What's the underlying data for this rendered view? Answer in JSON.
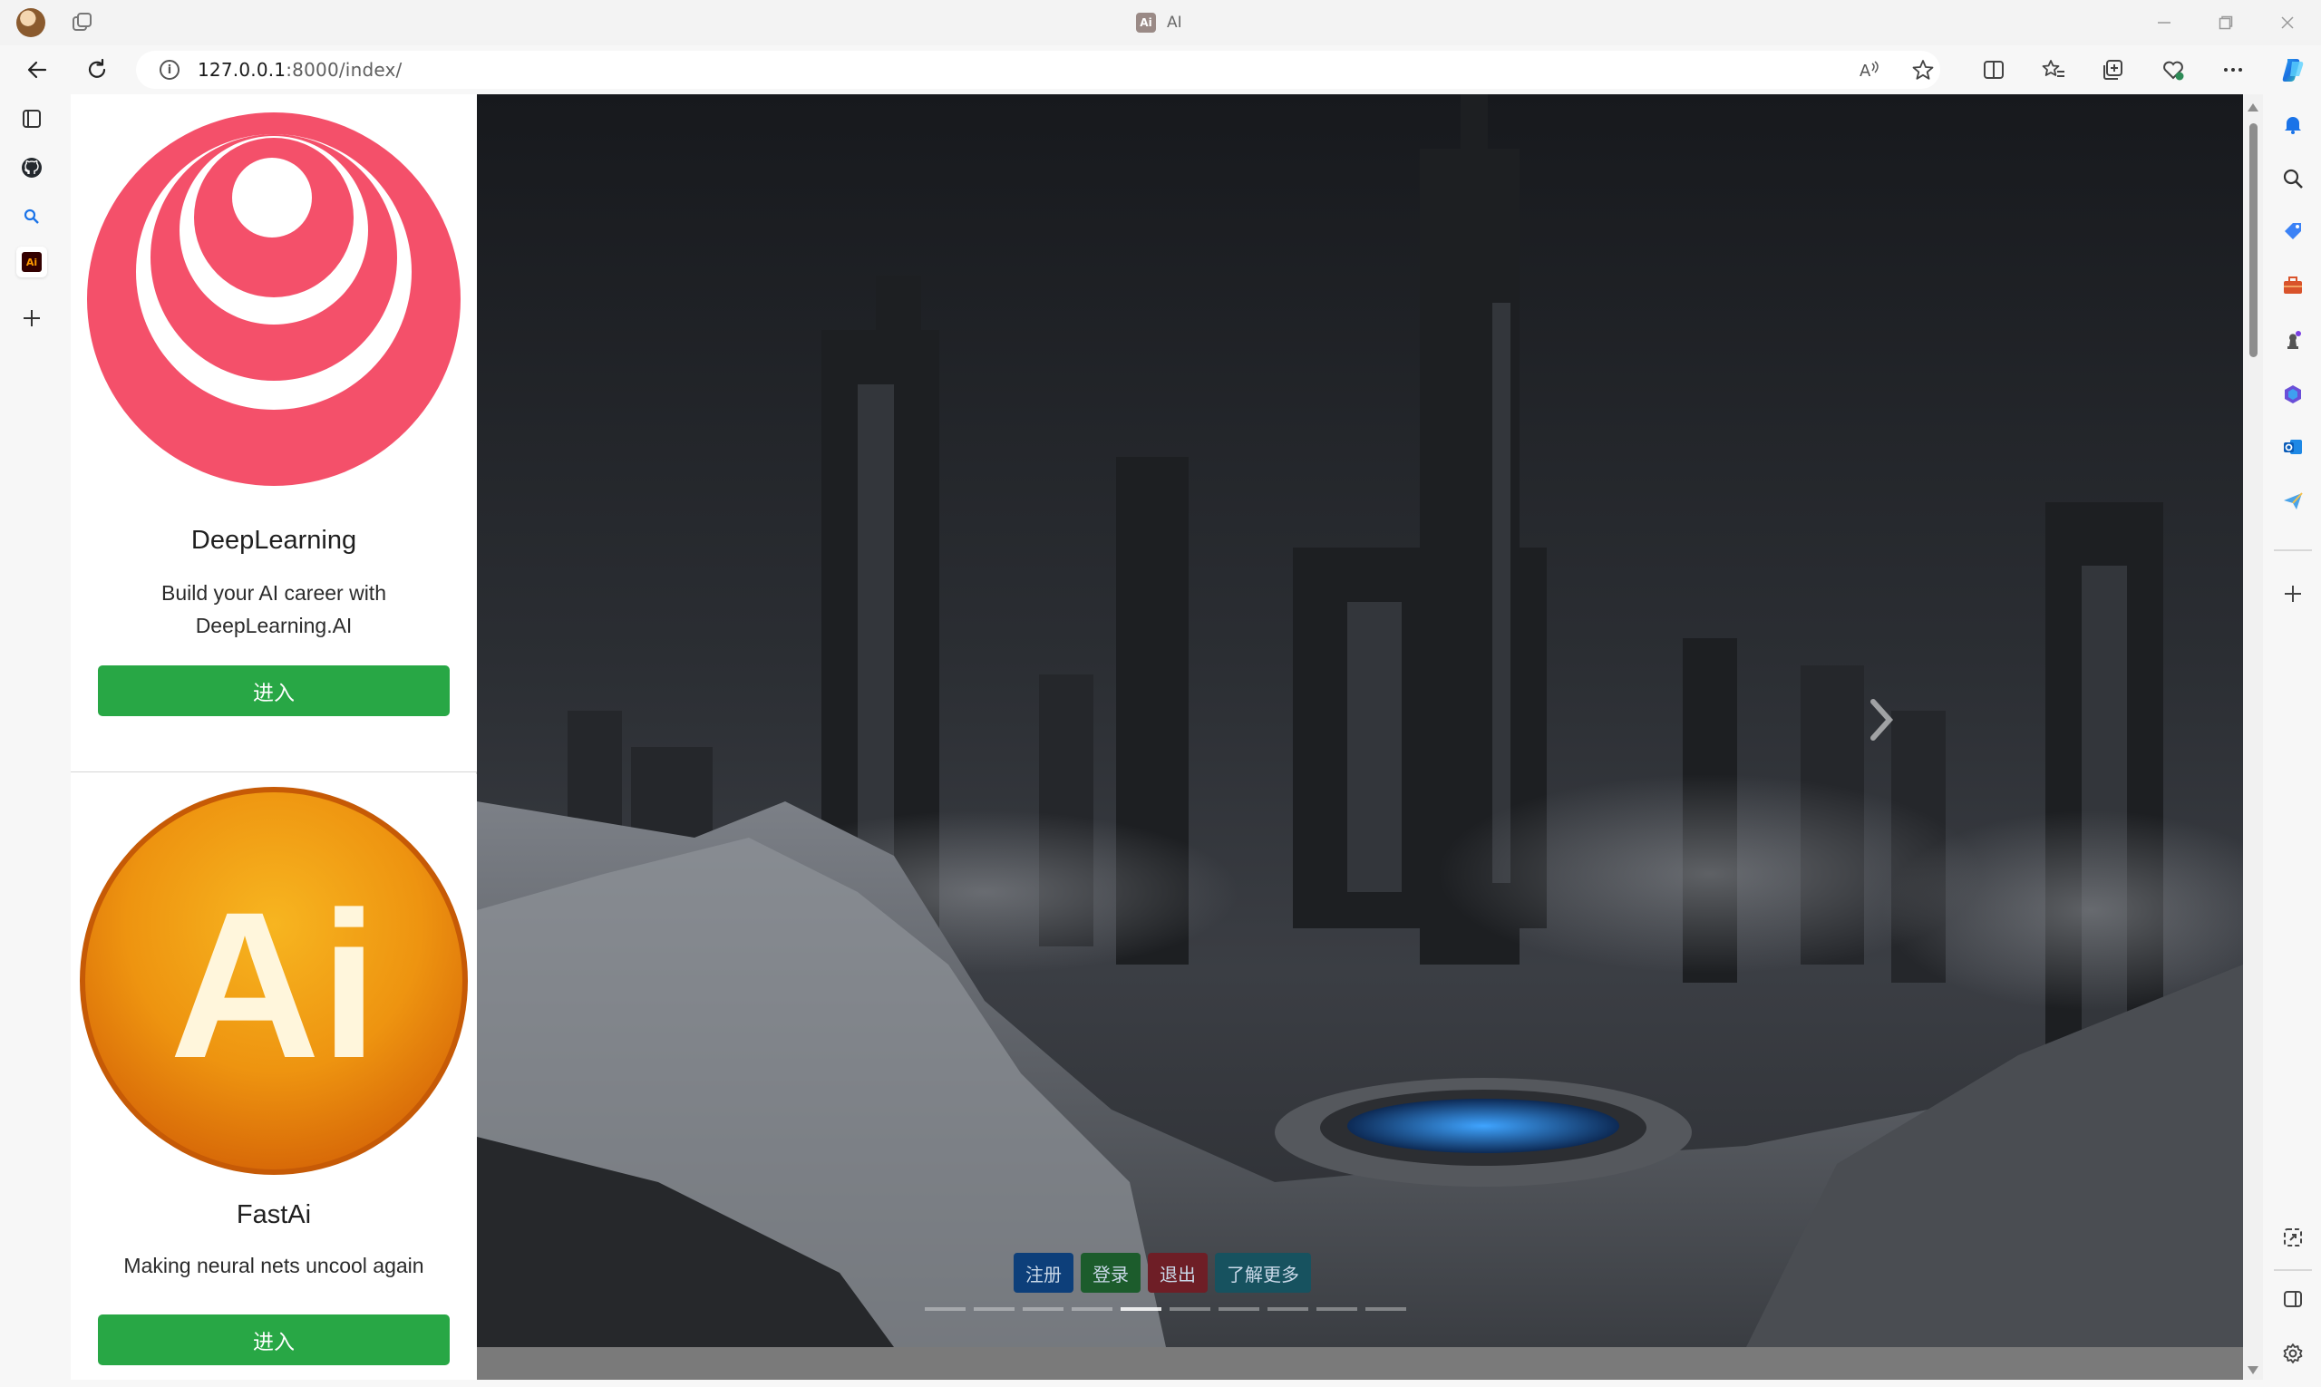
{
  "browser": {
    "tab_title": "AI",
    "tab_favicon_text": "Ai",
    "url_host": "127.0.0.1",
    "url_rest": ":8000/index/"
  },
  "cards": [
    {
      "title": "DeepLearning",
      "description": "Build your AI career with DeepLearning.AI",
      "button_label": "进入",
      "logo_icon": "concentric-circles-logo",
      "accent": "#f4506a"
    },
    {
      "title": "FastAi",
      "description": "Making neural nets uncool again",
      "button_label": "进入",
      "logo_icon": "ai-orange-badge",
      "logo_text": "Ai",
      "accent": "#f0a020"
    }
  ],
  "hero": {
    "buttons": [
      {
        "label": "注册",
        "style": "primary"
      },
      {
        "label": "登录",
        "style": "success"
      },
      {
        "label": "退出",
        "style": "danger"
      },
      {
        "label": "了解更多",
        "style": "info"
      }
    ],
    "indicator_count": 10,
    "active_indicator": 4
  },
  "colors": {
    "button_success": "#28a745"
  }
}
